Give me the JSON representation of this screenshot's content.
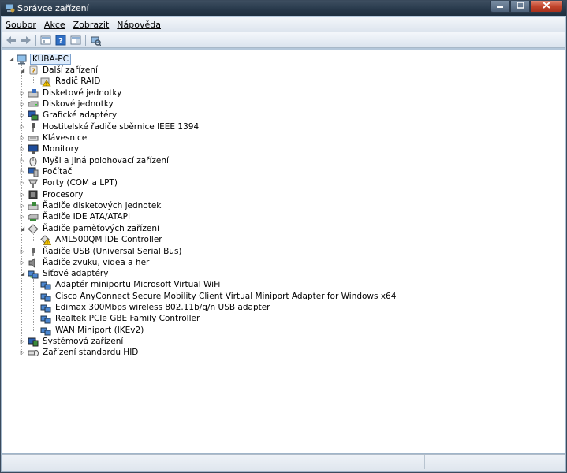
{
  "window": {
    "title": "Správce zařízení",
    "icon": "device-manager-icon",
    "buttons": {
      "minimize": "minimize-icon",
      "maximize": "maximize-icon",
      "close": "close-icon"
    }
  },
  "menubar": {
    "items": [
      {
        "label": "Soubor"
      },
      {
        "label": "Akce"
      },
      {
        "label": "Zobrazit"
      },
      {
        "label": "Nápověda"
      }
    ]
  },
  "toolbar": {
    "icons": [
      "back-arrow-icon",
      "forward-arrow-icon",
      "properties-view-icon",
      "help-icon",
      "console-tree-icon",
      "scan-hardware-icon"
    ]
  },
  "tree": {
    "root": {
      "label": "KUBA-PC",
      "icon": "computer-icon",
      "expanded": true
    },
    "nodes": [
      {
        "label": "Další zařízení",
        "icon": "unknown-device-icon",
        "level": 1,
        "expanded": true
      },
      {
        "label": "Řadič RAID",
        "icon": "warning-device-icon",
        "level": 2
      },
      {
        "label": "Disketové jednotky",
        "icon": "floppy-drive-icon",
        "level": 1
      },
      {
        "label": "Diskové jednotky",
        "icon": "disk-drive-icon",
        "level": 1
      },
      {
        "label": "Grafické adaptéry",
        "icon": "display-adapter-icon",
        "level": 1
      },
      {
        "label": "Hostitelské řadiče sběrnice IEEE 1394",
        "icon": "ieee1394-icon",
        "level": 1
      },
      {
        "label": "Klávesnice",
        "icon": "keyboard-icon",
        "level": 1
      },
      {
        "label": "Monitory",
        "icon": "monitor-icon",
        "level": 1
      },
      {
        "label": "Myši a jiná polohovací zařízení",
        "icon": "mouse-icon",
        "level": 1
      },
      {
        "label": "Počítač",
        "icon": "computer-small-icon",
        "level": 1
      },
      {
        "label": "Porty (COM a LPT)",
        "icon": "port-icon",
        "level": 1
      },
      {
        "label": "Procesory",
        "icon": "processor-icon",
        "level": 1
      },
      {
        "label": "Řadiče disketových jednotek",
        "icon": "floppy-controller-icon",
        "level": 1
      },
      {
        "label": "Řadiče IDE ATA/ATAPI",
        "icon": "ide-controller-icon",
        "level": 1
      },
      {
        "label": "Řadiče paměťových zařízení",
        "icon": "storage-controller-icon",
        "level": 1,
        "expanded": true
      },
      {
        "label": "AML500QM IDE Controller",
        "icon": "warning-storage-icon",
        "level": 2
      },
      {
        "label": "Řadiče USB (Universal Serial Bus)",
        "icon": "usb-icon",
        "level": 1
      },
      {
        "label": "Řadiče zvuku, videa a her",
        "icon": "sound-icon",
        "level": 1
      },
      {
        "label": "Síťové adaptéry",
        "icon": "network-adapter-icon",
        "level": 1,
        "expanded": true
      },
      {
        "label": "Adaptér miniportu Microsoft Virtual WiFi",
        "icon": "network-adapter-icon",
        "level": 2
      },
      {
        "label": "Cisco AnyConnect Secure Mobility Client Virtual Miniport Adapter for Windows x64",
        "icon": "network-adapter-icon",
        "level": 2
      },
      {
        "label": "Edimax 300Mbps wireless 802.11b/g/n USB adapter",
        "icon": "network-adapter-icon",
        "level": 2
      },
      {
        "label": "Realtek PCIe GBE Family Controller",
        "icon": "network-adapter-icon",
        "level": 2
      },
      {
        "label": "WAN Miniport (IKEv2)",
        "icon": "network-adapter-icon",
        "level": 2
      },
      {
        "label": "Systémová zařízení",
        "icon": "system-device-icon",
        "level": 1
      },
      {
        "label": "Zařízení standardu HID",
        "icon": "hid-device-icon",
        "level": 1
      }
    ]
  }
}
